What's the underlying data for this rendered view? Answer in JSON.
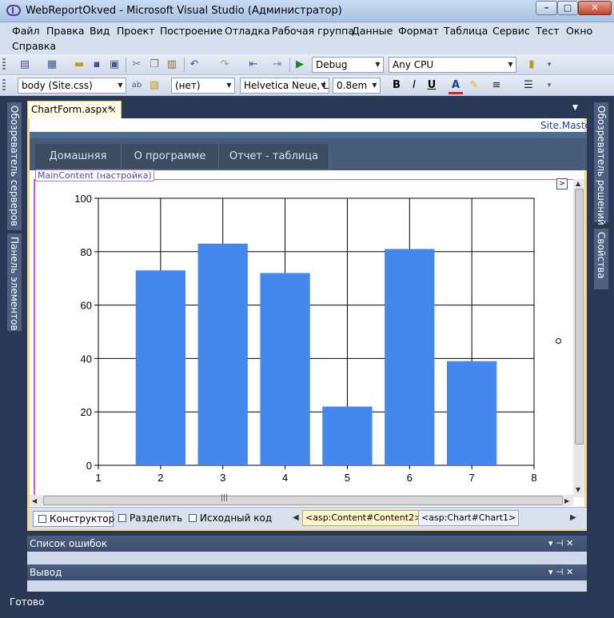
{
  "window": {
    "title": "WebReportOkved - Microsoft Visual Studio (Администратор)",
    "min_glyph": "–",
    "max_glyph": "□",
    "close_glyph": "✕"
  },
  "menu": [
    "Файл",
    "Правка",
    "Вид",
    "Проект",
    "Построение",
    "Отладка",
    "Рабочая группа",
    "Данные",
    "Формат",
    "Таблица",
    "Сервис",
    "Тест",
    "Окно",
    "Справка"
  ],
  "toolbar1": {
    "config": "Debug",
    "platform": "Any CPU",
    "start_glyph": "▶"
  },
  "toolbar2": {
    "style_target": "body (Site.css)",
    "block_format": "(нет)",
    "font_name": "Helvetica Neue, L",
    "font_size": "0.8em",
    "bold": "B",
    "italic": "I",
    "underline": "U",
    "font_color_glyph": "A"
  },
  "side_panels": {
    "left": [
      "Обозреватель серверов",
      "Панель элементов"
    ],
    "right": [
      "Обозреватель решений",
      "Свойства"
    ]
  },
  "document": {
    "tab_label": "ChartForm.aspx*",
    "close_glyph": "×",
    "master": "Site.Master",
    "nav_tabs": [
      "Домашняя",
      "О программе",
      "Отчет - таблица"
    ],
    "content_label": "MainContent (настройка)",
    "smart_tag": ">"
  },
  "views": {
    "designer": "Конструктор",
    "split": "Разделить",
    "source": "Исходный код"
  },
  "breadcrumbs": [
    "<asp:Content#Content2>",
    "<asp:Chart#Chart1>"
  ],
  "tool_windows": {
    "errors_title": "Список ошибок",
    "output_title": "Вывод",
    "pin_glyph": "▾ ⊣ ✕"
  },
  "status": "Готово",
  "colors": {
    "bar": "#4488ee",
    "vs_frame": "#293955",
    "content_border": "#c25be0"
  },
  "chart_data": {
    "type": "bar",
    "x": [
      2,
      3,
      4,
      5,
      6,
      7
    ],
    "values": [
      73,
      83,
      72,
      22,
      81,
      39
    ],
    "xlim": [
      1,
      8
    ],
    "ylim": [
      0,
      100
    ],
    "xticks": [
      "1",
      "2",
      "3",
      "4",
      "5",
      "6",
      "7",
      "8"
    ],
    "yticks": [
      "0",
      "20",
      "40",
      "60",
      "80",
      "100"
    ],
    "grid": true,
    "title": "",
    "xlabel": "",
    "ylabel": ""
  }
}
